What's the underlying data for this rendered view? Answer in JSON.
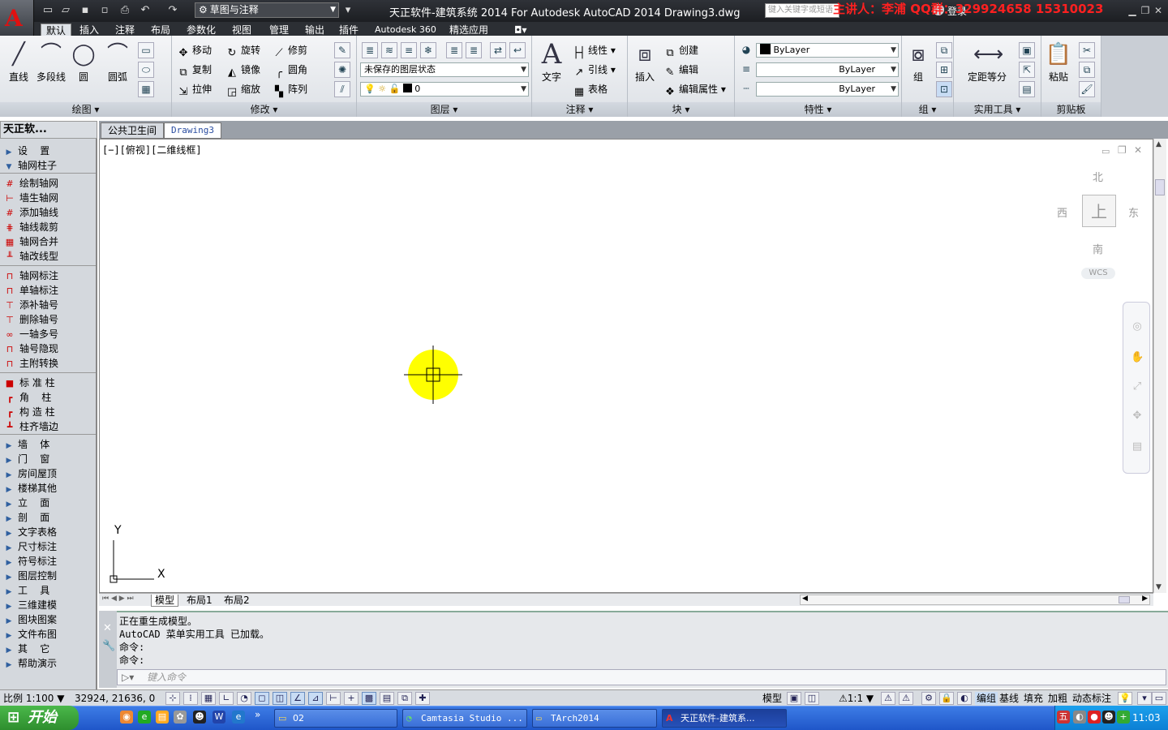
{
  "titlebar": {
    "workspace": "草图与注释",
    "title": "天正软件-建筑系统 2014  For Autodesk AutoCAD 2014    Drawing3.dwg",
    "search_placeholder": "键入关键字或短语",
    "overlay_text": "主讲人：李浦   QQ群：329924658   15310023",
    "signin": "登录"
  },
  "ribbon_tabs": [
    "默认",
    "插入",
    "注释",
    "布局",
    "参数化",
    "视图",
    "管理",
    "输出",
    "插件",
    "Autodesk 360",
    "精选应用"
  ],
  "panels": {
    "draw": {
      "title": "绘图",
      "line": "直线",
      "polyline": "多段线",
      "circle": "圆",
      "arc": "圆弧"
    },
    "modify": {
      "title": "修改",
      "move": "移动",
      "rotate": "旋转",
      "trim": "修剪",
      "copy": "复制",
      "mirror": "镜像",
      "fillet": "圆角",
      "stretch": "拉伸",
      "scale": "缩放",
      "array": "阵列"
    },
    "layers": {
      "title": "图层",
      "state": "未保存的图层状态",
      "current": "0"
    },
    "annotation": {
      "title": "注释",
      "text": "文字",
      "dim": "线性",
      "leader": "引线",
      "table": "表格"
    },
    "block": {
      "title": "块",
      "insert": "插入",
      "create": "创建",
      "edit": "编辑",
      "edit_attr": "编辑属性"
    },
    "properties": {
      "title": "特性",
      "color": "ByLayer",
      "linetype": "ByLayer",
      "lineweight": "ByLayer"
    },
    "groups": {
      "title": "组",
      "group": "组"
    },
    "utilities": {
      "title": "实用工具",
      "measure": "定距等分"
    },
    "clipboard": {
      "title": "剪贴板",
      "paste": "粘贴"
    }
  },
  "left_panel": {
    "title": "天正软...",
    "items": [
      {
        "label": "设    置",
        "type": "section",
        "icon": "▶"
      },
      {
        "label": "轴网柱子",
        "type": "section-open",
        "icon": "▼"
      },
      {
        "label": "绘制轴网",
        "type": "cmd",
        "icon": "#"
      },
      {
        "label": "墙生轴网",
        "type": "cmd",
        "icon": "⊢"
      },
      {
        "label": "添加轴线",
        "type": "cmd",
        "icon": "#"
      },
      {
        "label": "轴线裁剪",
        "type": "cmd",
        "icon": "⋕"
      },
      {
        "label": "轴网合并",
        "type": "cmd",
        "icon": "▦"
      },
      {
        "label": "轴改线型",
        "type": "cmd",
        "icon": "╨"
      },
      {
        "label": "轴网标注",
        "type": "cmd",
        "icon": "⊓"
      },
      {
        "label": "单轴标注",
        "type": "cmd",
        "icon": "⊓"
      },
      {
        "label": "添补轴号",
        "type": "cmd",
        "icon": "⊤"
      },
      {
        "label": "删除轴号",
        "type": "cmd",
        "icon": "⊤"
      },
      {
        "label": "一轴多号",
        "type": "cmd",
        "icon": "∞"
      },
      {
        "label": "轴号隐现",
        "type": "cmd",
        "icon": "⊓"
      },
      {
        "label": "主附转换",
        "type": "cmd",
        "icon": "⊓"
      },
      {
        "label": "标 准 柱",
        "type": "cmd",
        "icon": "■"
      },
      {
        "label": "角    柱",
        "type": "cmd",
        "icon": "┏"
      },
      {
        "label": "构 造 柱",
        "type": "cmd",
        "icon": "┏"
      },
      {
        "label": "柱齐墙边",
        "type": "cmd",
        "icon": "┻"
      },
      {
        "label": "墙    体",
        "type": "section",
        "icon": "▶"
      },
      {
        "label": "门    窗",
        "type": "section",
        "icon": "▶"
      },
      {
        "label": "房间屋顶",
        "type": "section",
        "icon": "▶"
      },
      {
        "label": "楼梯其他",
        "type": "section",
        "icon": "▶"
      },
      {
        "label": "立    面",
        "type": "section",
        "icon": "▶"
      },
      {
        "label": "剖    面",
        "type": "section",
        "icon": "▶"
      },
      {
        "label": "文字表格",
        "type": "section",
        "icon": "▶"
      },
      {
        "label": "尺寸标注",
        "type": "section",
        "icon": "▶"
      },
      {
        "label": "符号标注",
        "type": "section",
        "icon": "▶"
      },
      {
        "label": "图层控制",
        "type": "section",
        "icon": "▶"
      },
      {
        "label": "工    具",
        "type": "section",
        "icon": "▶"
      },
      {
        "label": "三维建模",
        "type": "section",
        "icon": "▶"
      },
      {
        "label": "图块图案",
        "type": "section",
        "icon": "▶"
      },
      {
        "label": "文件布图",
        "type": "section",
        "icon": "▶"
      },
      {
        "label": "其    它",
        "type": "section",
        "icon": "▶"
      },
      {
        "label": "帮助演示",
        "type": "section",
        "icon": "▶"
      }
    ]
  },
  "doc_tabs": [
    "公共卫生间",
    "Drawing3"
  ],
  "canvas": {
    "viewport_label": "[−][俯视][二维线框]",
    "compass": {
      "n": "北",
      "s": "南",
      "e": "东",
      "w": "西",
      "top": "上"
    },
    "wcs": "WCS",
    "ucs_x": "X",
    "ucs_y": "Y"
  },
  "layout_tabs": [
    "模型",
    "布局1",
    "布局2"
  ],
  "command": {
    "lines": [
      "正在重生成模型。",
      "AutoCAD 菜单实用工具 已加载。",
      "命令:",
      "命令:"
    ],
    "placeholder": "键入命令"
  },
  "status": {
    "scale": "比例 1:100",
    "coords": "32924, 21636, 0",
    "model": "模型",
    "anno_scale": "1:1",
    "toggles": [
      "编组",
      "基线",
      "填充",
      "加粗",
      "动态标注"
    ]
  },
  "taskbar": {
    "start": "开始",
    "buttons": [
      "02",
      "Camtasia Studio ...",
      "TArch2014",
      "天正软件-建筑系..."
    ],
    "clock": "11:03"
  }
}
